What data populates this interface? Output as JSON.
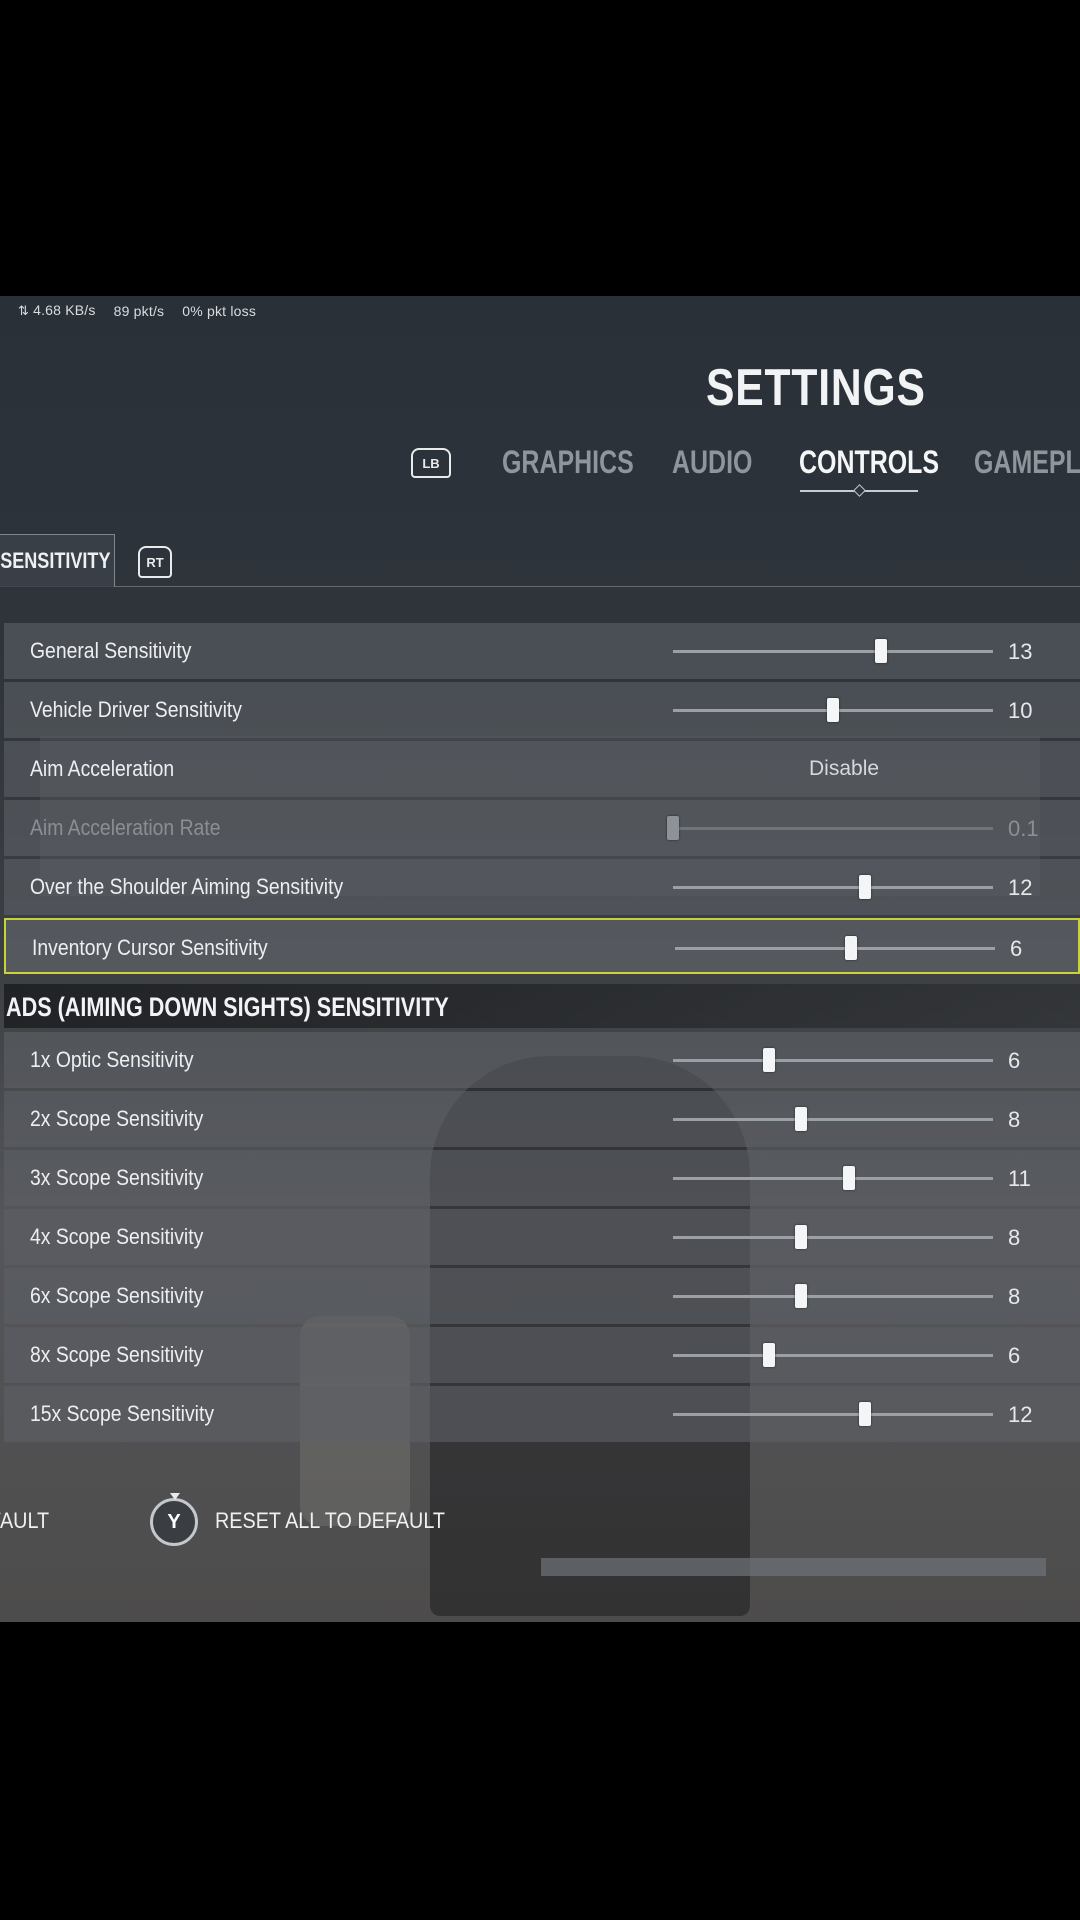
{
  "netstats": {
    "icon": "network-arrows-icon",
    "speed": "4.68 KB/s",
    "packets": "89 pkt/s",
    "loss": "0% pkt loss"
  },
  "title": "SETTINGS",
  "main_tabs": {
    "lb_label": "LB",
    "items": [
      "GRAPHICS",
      "AUDIO",
      "CONTROLS",
      "GAMEPLAY"
    ],
    "active": "CONTROLS"
  },
  "sub_tabs": {
    "active_label": "SENSITIVITY",
    "rt_label": "RT"
  },
  "general_rows": [
    {
      "label": "General Sensitivity",
      "value": "13",
      "level": 0.65
    },
    {
      "label": "Vehicle Driver Sensitivity",
      "value": "10",
      "level": 0.5
    },
    {
      "label": "Aim Acceleration",
      "option": "Disable"
    },
    {
      "label": "Aim Acceleration Rate",
      "value": "0.1",
      "level": 0.0,
      "disabled": true
    },
    {
      "label": "Over the Shoulder Aiming Sensitivity",
      "value": "12",
      "level": 0.6
    },
    {
      "label": "Inventory Cursor Sensitivity",
      "value": "6",
      "level": 0.55,
      "selected": true
    }
  ],
  "ads_section": {
    "title": "ADS (AIMING DOWN SIGHTS) SENSITIVITY",
    "rows": [
      {
        "label": "1x Optic Sensitivity",
        "value": "6",
        "level": 0.3
      },
      {
        "label": "2x Scope Sensitivity",
        "value": "8",
        "level": 0.4
      },
      {
        "label": "3x Scope Sensitivity",
        "value": "11",
        "level": 0.55
      },
      {
        "label": "4x Scope Sensitivity",
        "value": "8",
        "level": 0.4
      },
      {
        "label": "6x Scope Sensitivity",
        "value": "8",
        "level": 0.4
      },
      {
        "label": "8x Scope Sensitivity",
        "value": "6",
        "level": 0.3
      },
      {
        "label": "15x Scope Sensitivity",
        "value": "12",
        "level": 0.6
      }
    ]
  },
  "footer": {
    "reset_label": "RESET TO DEFAULT",
    "y_button": "Y",
    "reset_all_label": "RESET ALL TO DEFAULT"
  }
}
